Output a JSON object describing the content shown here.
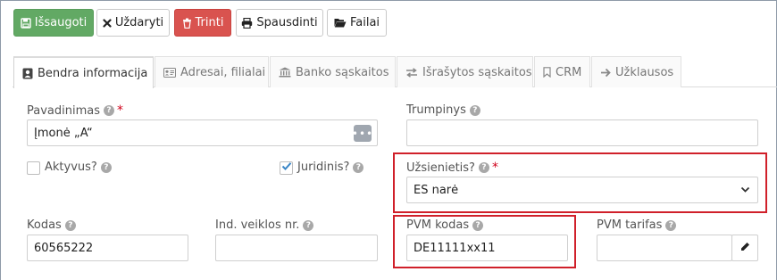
{
  "toolbar": {
    "save_label": "Išsaugoti",
    "close_label": "Uždaryti",
    "delete_label": "Trinti",
    "print_label": "Spausdinti",
    "files_label": "Failai"
  },
  "tabs": [
    {
      "label": "Bendra informacija",
      "icon": "contact-card-icon",
      "active": true
    },
    {
      "label": "Adresai, filialai",
      "icon": "address-card-icon"
    },
    {
      "label": "Banko sąskaitos",
      "icon": "bank-icon"
    },
    {
      "label": "Išrašytos sąskaitos",
      "icon": "exchange-icon"
    },
    {
      "label": "CRM",
      "icon": "bookmark-icon"
    },
    {
      "label": "Užklausos",
      "icon": "arrow-right-icon"
    }
  ],
  "form": {
    "name": {
      "label": "Pavadinimas",
      "value": "Įmonė „A“"
    },
    "short_name": {
      "label": "Trumpinys",
      "value": ""
    },
    "active": {
      "label": "Aktyvus?",
      "checked": false
    },
    "legal": {
      "label": "Juridinis?",
      "checked": true
    },
    "foreign": {
      "label": "Užsienietis?",
      "value": "ES narė"
    },
    "code": {
      "label": "Kodas",
      "value": "60565222"
    },
    "activity_no": {
      "label": "Ind. veiklos nr.",
      "value": ""
    },
    "vat_code": {
      "label": "PVM kodas",
      "value": "DE11111xx11"
    },
    "vat_rate": {
      "label": "PVM tarifas",
      "value": ""
    }
  },
  "colors": {
    "save": "#62a964",
    "delete": "#d9534f",
    "highlight": "#d0202a",
    "required": "#d0021b"
  }
}
